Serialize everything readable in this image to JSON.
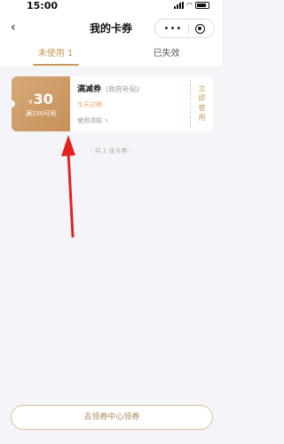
{
  "status_bar": {
    "time": "15:00"
  },
  "nav": {
    "title": "我的卡券",
    "back_icon": "chevron-left-icon",
    "more_icon": "more-icon",
    "close_icon": "close-icon"
  },
  "tabs": [
    {
      "label": "未使用 1",
      "active": true
    },
    {
      "label": "已失效",
      "active": false
    }
  ],
  "coupon": {
    "currency": "¥",
    "amount": "30",
    "condition": "满100可用",
    "name": "满减券",
    "sub": "(政府补贴)",
    "expire": "今天过期",
    "usage": "使用须知",
    "use_now": "立即使用"
  },
  "total": "- 共 1 张卡券 -",
  "bottom_button": "去领券中心领券",
  "colors": {
    "accent": "#c89a5e",
    "arrow": "#e32222"
  }
}
